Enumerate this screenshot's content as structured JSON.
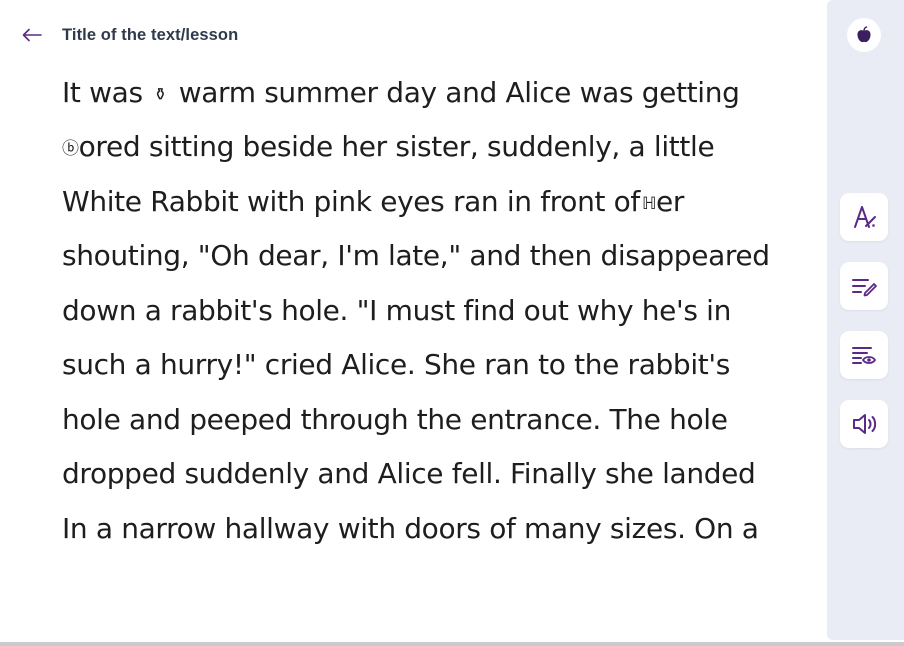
{
  "header": {
    "back_icon": "arrow-left-icon",
    "title": "Title of the text/lesson"
  },
  "reading": {
    "lines": [
      {
        "before": "It was ",
        "glyph": "⚱",
        "after": " warm summer day and Alice was getting"
      },
      {
        "before": "",
        "glyph": "ⓑ",
        "after": "ored sitting beside her sister, suddenly, a little"
      },
      {
        "before": "White Rabbit with pink eyes ran in front of",
        "glyph": "ℍ",
        "after": "er"
      },
      {
        "before": "shouting, \"Oh dear, I'm late,\" and then disappeared",
        "glyph": "",
        "after": ""
      },
      {
        "before": "down a rabbit's hole. \"I must find out why he's in",
        "glyph": "",
        "after": ""
      },
      {
        "before": "such a hurry!\" cried Alice. She ran to the rabbit's",
        "glyph": "",
        "after": ""
      },
      {
        "before": "hole and peeped through the entrance. The hole",
        "glyph": "",
        "after": ""
      },
      {
        "before": "dropped suddenly and Alice fell. Finally she landed",
        "glyph": "",
        "after": ""
      },
      {
        "before": "In a narrow hallway with doors of many sizes. On a",
        "glyph": "",
        "after": ""
      }
    ]
  },
  "toolbar": {
    "top_icon": "apple-icon",
    "buttons": [
      {
        "name": "font-style-button",
        "icon": "font-style-icon"
      },
      {
        "name": "annotate-button",
        "icon": "edit-lines-icon"
      },
      {
        "name": "reading-view-button",
        "icon": "lines-eye-icon"
      },
      {
        "name": "text-to-speech-button",
        "icon": "speaker-icon"
      }
    ]
  },
  "colors": {
    "accent": "#5b2a86",
    "toolbar_bg": "#e9ebf5",
    "title": "#2f3a4c",
    "body_text": "#1e1e1e"
  }
}
